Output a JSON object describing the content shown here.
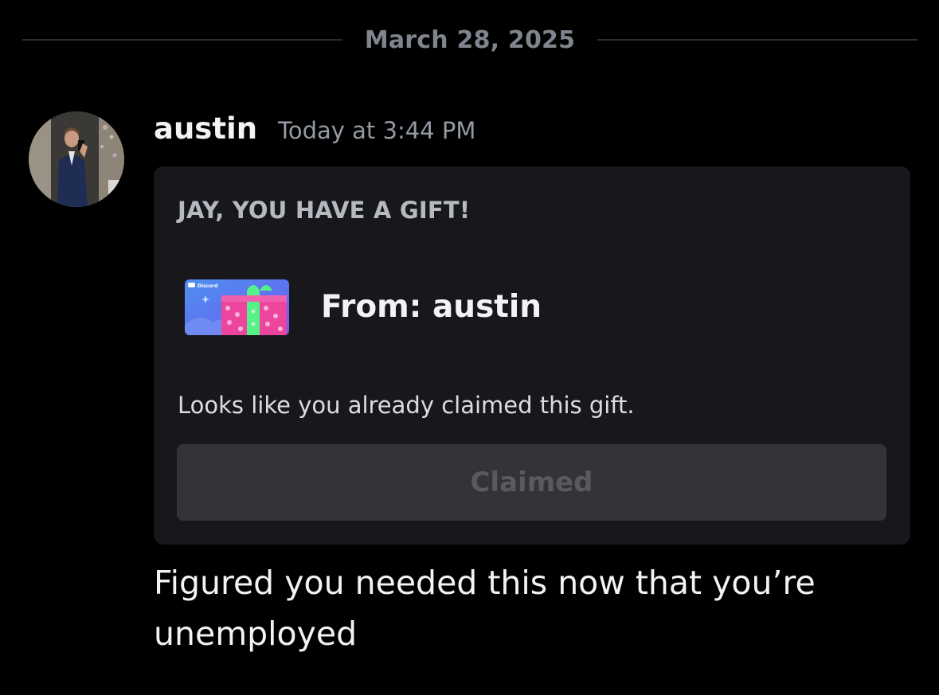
{
  "date_divider": {
    "label": "March 28, 2025"
  },
  "message": {
    "author": "austin",
    "timestamp": "Today at 3:44 PM",
    "text": "Figured you needed this now that you’re unemployed"
  },
  "gift": {
    "heading": "JAY, YOU HAVE A GIFT!",
    "from_label": "From: austin",
    "status_text": "Looks like you already claimed this gift.",
    "button_label": "Claimed",
    "button_enabled": false,
    "thumbnail_brand": "Discord"
  },
  "colors": {
    "background": "#000000",
    "card_background": "#18181c",
    "button_background": "#333338",
    "button_text": "#585a60",
    "muted_text": "#949ba4",
    "divider_text": "#80848e",
    "gift_blurple": "#5865f2",
    "gift_pink": "#eb459e",
    "gift_green": "#57f287"
  }
}
